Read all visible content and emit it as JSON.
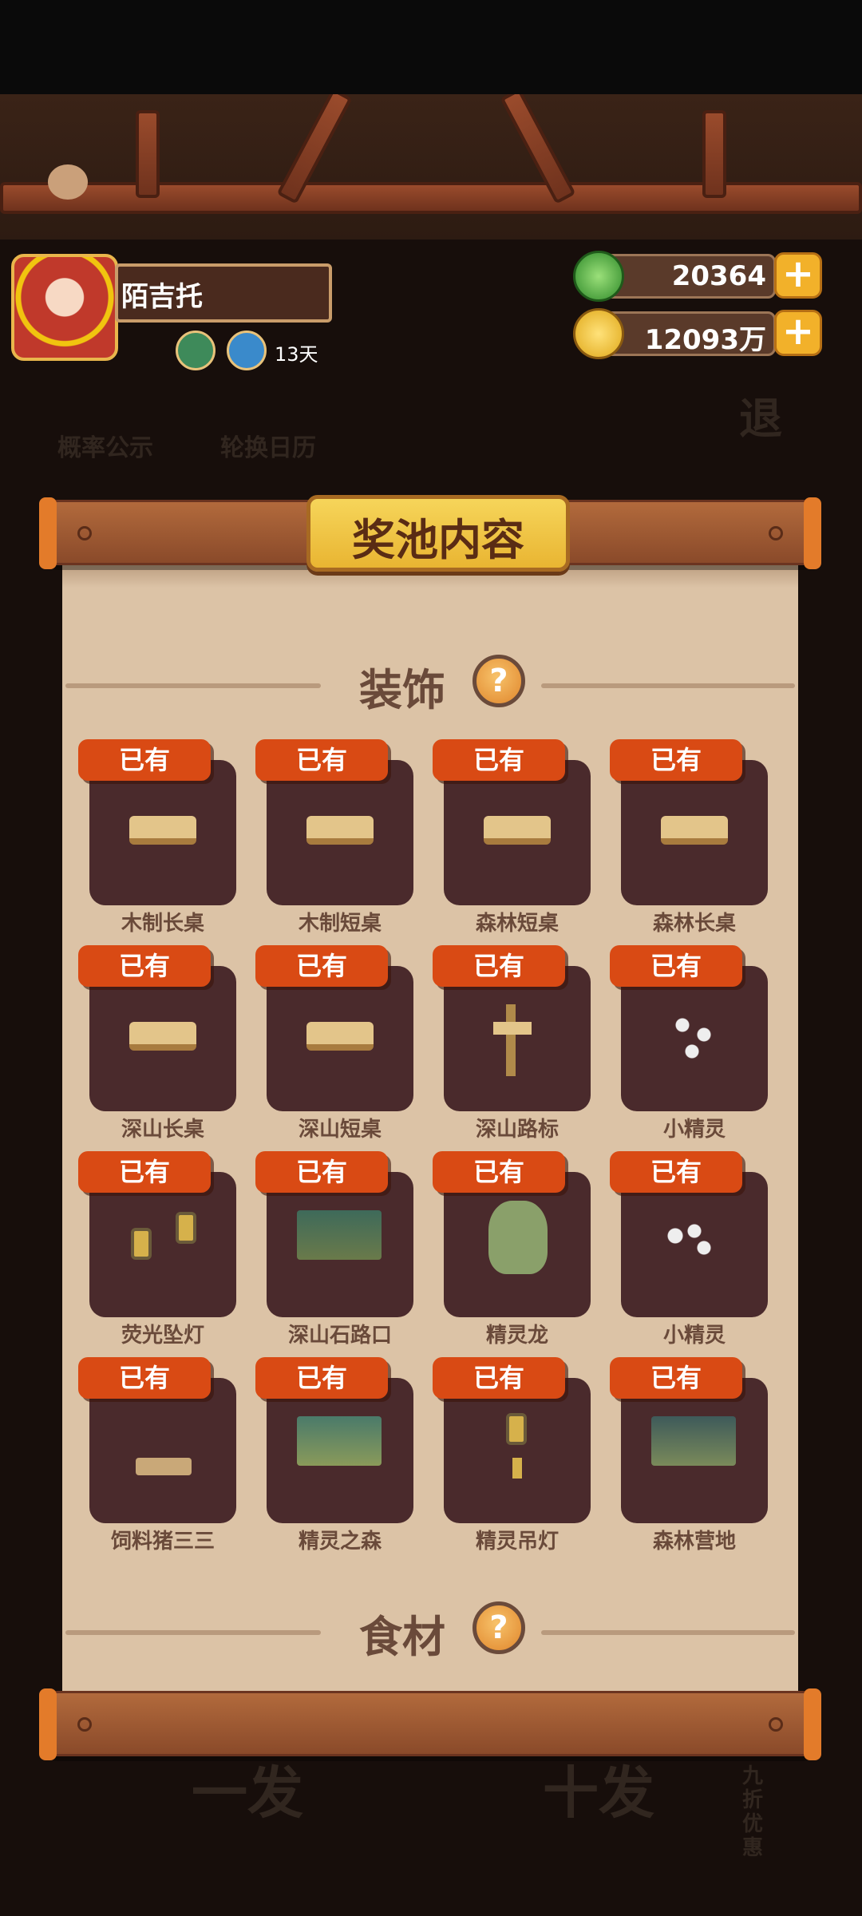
{
  "profile": {
    "name": "陌吉托",
    "days": "13天"
  },
  "currency": {
    "jade": "20364",
    "coins": "12093万",
    "plus": "+"
  },
  "background_menu": {
    "probability": "概率公示",
    "calendar": "轮换日历",
    "exit": "退",
    "single": "一发",
    "ten": "十发",
    "discount": "九折优惠"
  },
  "panel": {
    "title": "奖池内容",
    "sections": [
      {
        "title": "装饰",
        "help": "?"
      },
      {
        "title": "食材",
        "help": "?"
      }
    ],
    "owned_label": "已有",
    "items": [
      {
        "name": "木制长桌"
      },
      {
        "name": "木制短桌"
      },
      {
        "name": "森林短桌"
      },
      {
        "name": "森林长桌"
      },
      {
        "name": "深山长桌"
      },
      {
        "name": "深山短桌"
      },
      {
        "name": "深山路标"
      },
      {
        "name": "小精灵"
      },
      {
        "name": "荧光坠灯"
      },
      {
        "name": "深山石路口"
      },
      {
        "name": "精灵龙"
      },
      {
        "name": "小精灵"
      },
      {
        "name": "饲料猪三三"
      },
      {
        "name": "精灵之森"
      },
      {
        "name": "精灵吊灯"
      },
      {
        "name": "森林营地"
      }
    ]
  }
}
